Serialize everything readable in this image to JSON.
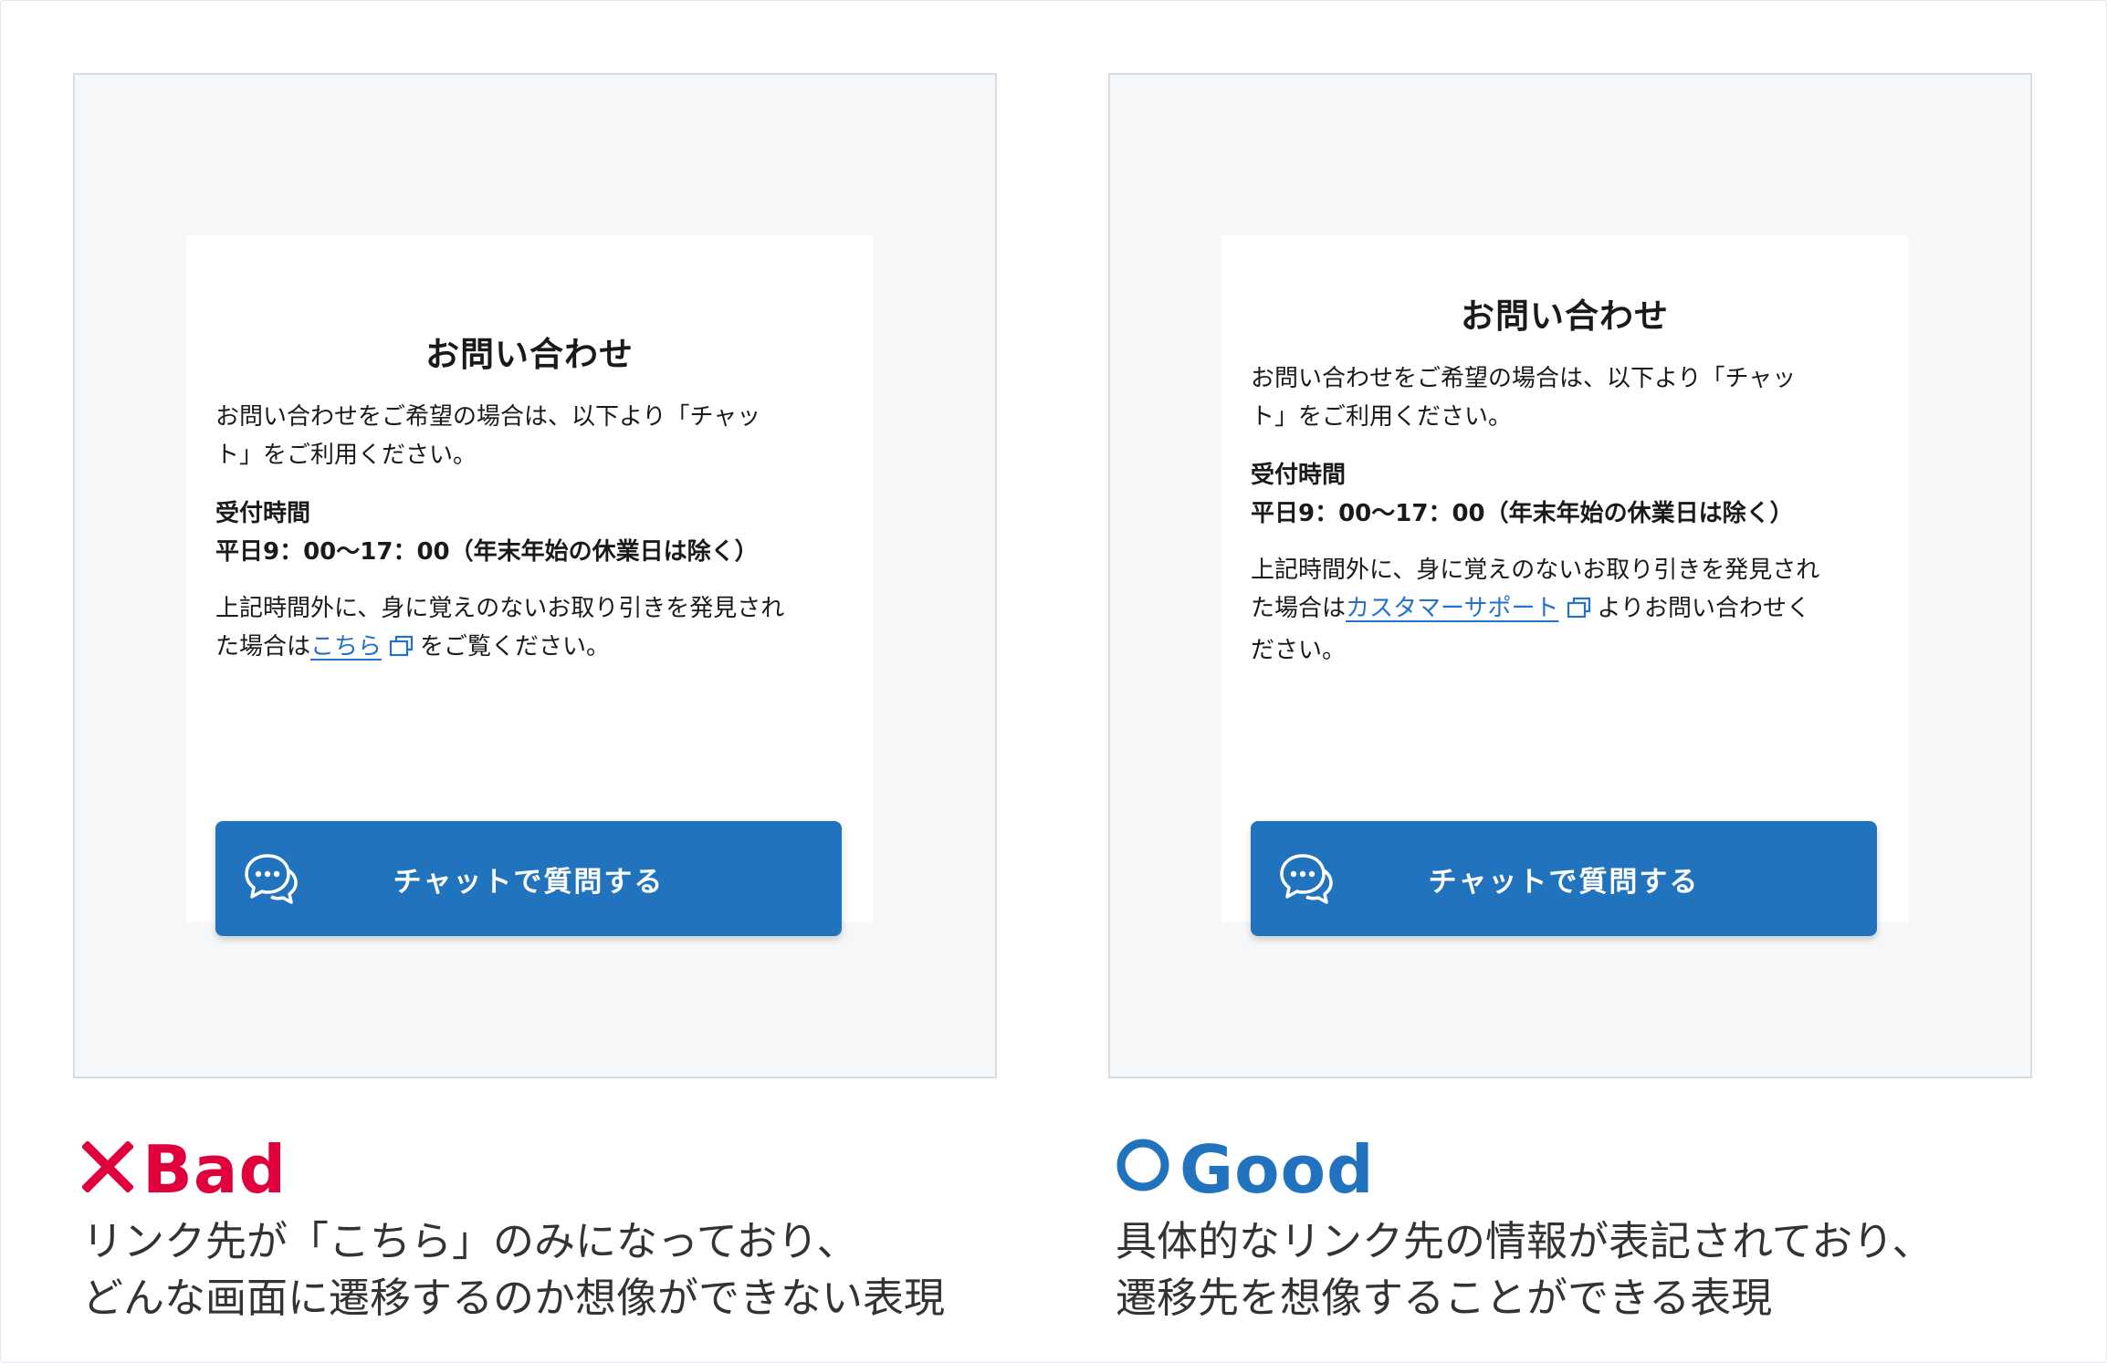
{
  "bad": {
    "card": {
      "title": "お問い合わせ",
      "intro_line1": "お問い合わせをご希望の場合は、以下より「チャッ",
      "intro_line2": "ト」をご利用ください。",
      "hours_label": "受付時間",
      "hours": "平日9：00〜17：00（年末年始の休業日は除く）",
      "note_line1": "上記時間外に、身に覚えのないお取り引きを発見され",
      "note_prefix": "た場合は",
      "link_text": "こちら",
      "note_suffix": "をご覧ください。",
      "chat_button": "チャットで質問する"
    },
    "verdict": "Bad",
    "desc_line1": "リンク先が「こちら」のみになっており、",
    "desc_line2": "どんな画面に遷移するのか想像ができない表現"
  },
  "good": {
    "card": {
      "title": "お問い合わせ",
      "intro_line1": "お問い合わせをご希望の場合は、以下より「チャッ",
      "intro_line2": "ト」をご利用ください。",
      "hours_label": "受付時間",
      "hours": "平日9：00〜17：00（年末年始の休業日は除く）",
      "note_line1": "上記時間外に、身に覚えのないお取り引きを発見され",
      "note_prefix": "た場合は",
      "link_text": "カスタマーサポート",
      "note_suffix": "よりお問い合わせく",
      "note_line3": "ださい。",
      "chat_button": "チャットで質問する"
    },
    "verdict": "Good",
    "desc_line1": "具体的なリンク先の情報が表記されており、",
    "desc_line2": "遷移先を想像することができる表現"
  },
  "icons": {
    "external_link": "external-link-icon",
    "chat": "chat-bubbles-icon",
    "bad_mark": "cross-icon",
    "good_mark": "circle-icon"
  },
  "colors": {
    "accent_blue": "#2273bd",
    "link_blue": "#2472c8",
    "bad_red": "#e0003c",
    "panel_bg": "#f6f7f9"
  }
}
